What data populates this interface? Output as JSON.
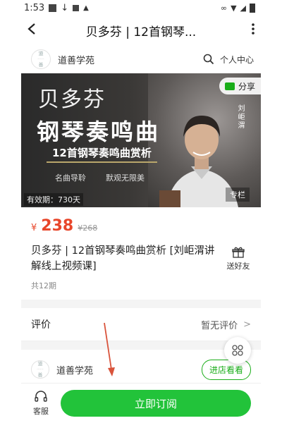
{
  "status_bar": {
    "time": "1:53"
  },
  "titlebar": {
    "title": "贝多芬 | 12首钢琴..."
  },
  "shop": {
    "name": "道善学苑",
    "user_center": "个人中心",
    "logo_top": "道",
    "logo_bottom": "善"
  },
  "banner": {
    "title_line1": "贝多芬",
    "title_line2": "钢琴奏鸣曲",
    "subtitle": "12首钢琴奏鸣曲赏析",
    "tags": [
      "名曲导聆",
      "默观无限美"
    ],
    "artist": "刘岠渭",
    "validity": "有效期：730天",
    "column_tag": "专栏",
    "share_label": "分享"
  },
  "price": {
    "currency": "¥",
    "current": "238",
    "original": "¥268"
  },
  "product": {
    "title": "贝多芬 | 12首钢琴奏鸣曲赏析 [刘岠渭讲解线上视频课]",
    "gift_label": "送好友",
    "episodes": "共12期"
  },
  "review": {
    "label": "评价",
    "value": "暂无评价",
    "arrow": ">"
  },
  "shop_footer": {
    "name": "道善学苑",
    "enter_label": "进店看看"
  },
  "bottom_bar": {
    "service_label": "客服",
    "subscribe_label": "立即订阅"
  },
  "colors": {
    "accent_green": "#22c33a",
    "price_red": "#e8462a",
    "wechat_green": "#1aad19"
  },
  "annotation": {
    "arrow_color": "#d9533b"
  }
}
